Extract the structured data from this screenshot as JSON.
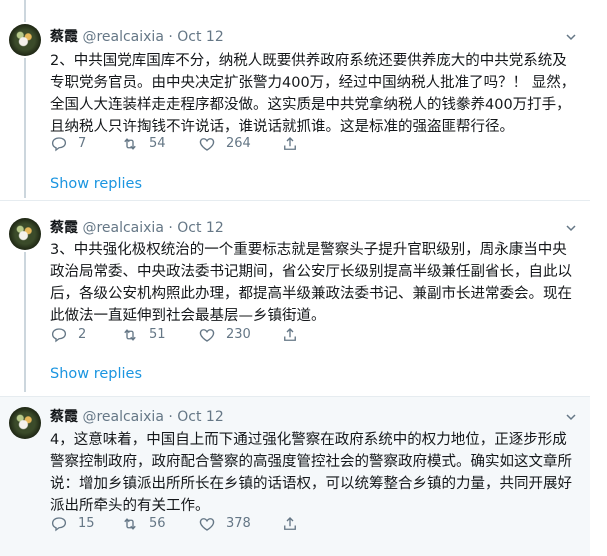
{
  "tweets": [
    {
      "author": "蔡霞",
      "handle": "@realcaixia",
      "separator": "·",
      "date": "Oct 12",
      "text": "2、中共国党库国库不分，纳税人既要供养政府系统还要供养庞大的中共党系统及专职党务官员。由中央决定扩张警力400万，经过中国纳税人批准了吗？！ 显然，全国人大连装样走走程序都没做。这实质是中共党拿纳税人的钱豢养400万打手，且纳税人只许掏钱不许说话，谁说话就抓谁。这是标准的强盗匪帮行径。",
      "replies": "7",
      "retweets": "54",
      "likes": "264",
      "show_replies": "Show replies"
    },
    {
      "author": "蔡霞",
      "handle": "@realcaixia",
      "separator": "·",
      "date": "Oct 12",
      "text": "3、中共强化极权统治的一个重要标志就是警察头子提升官职级别，周永康当中央政治局常委、中央政法委书记期间，省公安厅长级别提高半级兼任副省长，自此以后，各级公安机构照此办理，都提高半级兼政法委书记、兼副市长进常委会。现在此做法一直延伸到社会最基层—乡镇街道。",
      "replies": "2",
      "retweets": "51",
      "likes": "230",
      "show_replies": "Show replies"
    },
    {
      "author": "蔡霞",
      "handle": "@realcaixia",
      "separator": "·",
      "date": "Oct 12",
      "text": "4，这意味着，中国自上而下通过强化警察在政府系统中的权力地位，正逐步形成警察控制政府，政府配合警察的高强度管控社会的警察政府模式。确实如这文章所说：增加乡镇派出所所长在乡镇的话语权，可以统筹整合乡镇的力量，共同开展好派出所牵头的有关工作。",
      "replies": "15",
      "retweets": "56",
      "likes": "378"
    }
  ]
}
